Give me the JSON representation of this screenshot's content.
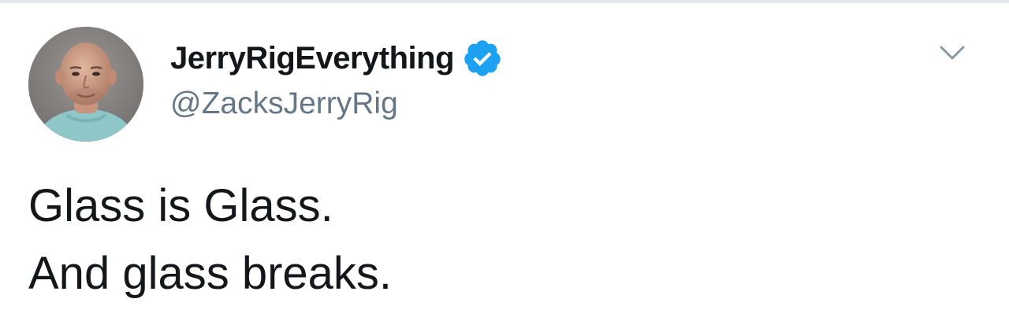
{
  "tweet": {
    "author": {
      "display_name": "JerryRigEverything",
      "handle": "@ZacksJerryRig",
      "verified": true,
      "verified_icon": "verified-badge-icon",
      "avatar": "profile-photo"
    },
    "menu_icon": "chevron-down-icon",
    "text_lines": [
      "Glass is Glass.",
      "And glass breaks."
    ]
  },
  "colors": {
    "name_text": "#14171a",
    "handle_text": "#657786",
    "verified_badge": "#1da1f2",
    "chevron": "#8899a6",
    "top_border": "#e1e8ed"
  }
}
